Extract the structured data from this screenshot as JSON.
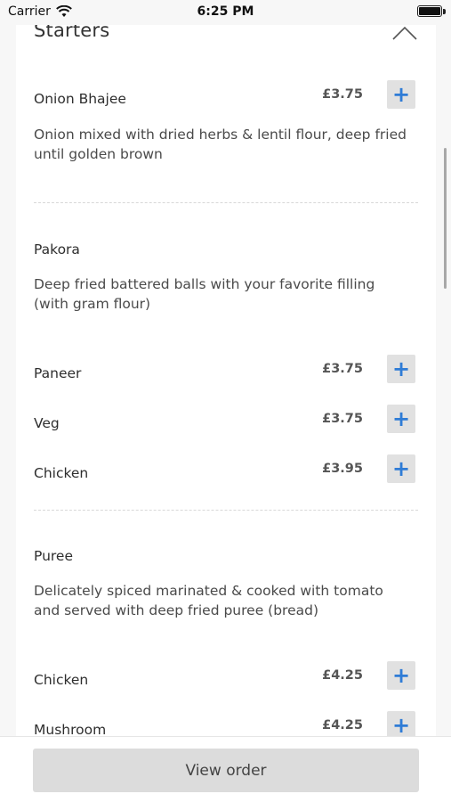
{
  "status_bar": {
    "carrier": "Carrier",
    "time": "6:25 PM"
  },
  "section": {
    "title": "Starters"
  },
  "items": {
    "onion_bhajee": {
      "name": "Onion Bhajee",
      "price": "£3.75",
      "description": "Onion mixed with dried herbs & lentil flour, deep fried until golden brown"
    },
    "pakora": {
      "name": "Pakora",
      "description": "Deep fried battered balls with your favorite filling (with gram flour)",
      "options": [
        {
          "name": "Paneer",
          "price": "£3.75"
        },
        {
          "name": "Veg",
          "price": "£3.75"
        },
        {
          "name": "Chicken",
          "price": "£3.95"
        }
      ]
    },
    "puree": {
      "name": "Puree",
      "description": "Delicately spiced marinated & cooked with tomato and served with deep fried puree (bread)",
      "options": [
        {
          "name": "Chicken",
          "price": "£4.25"
        },
        {
          "name": "Mushroom",
          "price": "£4.25"
        }
      ]
    }
  },
  "add_symbol": "+",
  "footer": {
    "view_order_label": "View order"
  },
  "colors": {
    "accent": "#2f7cd6",
    "button_bg": "#e1e1e1"
  }
}
